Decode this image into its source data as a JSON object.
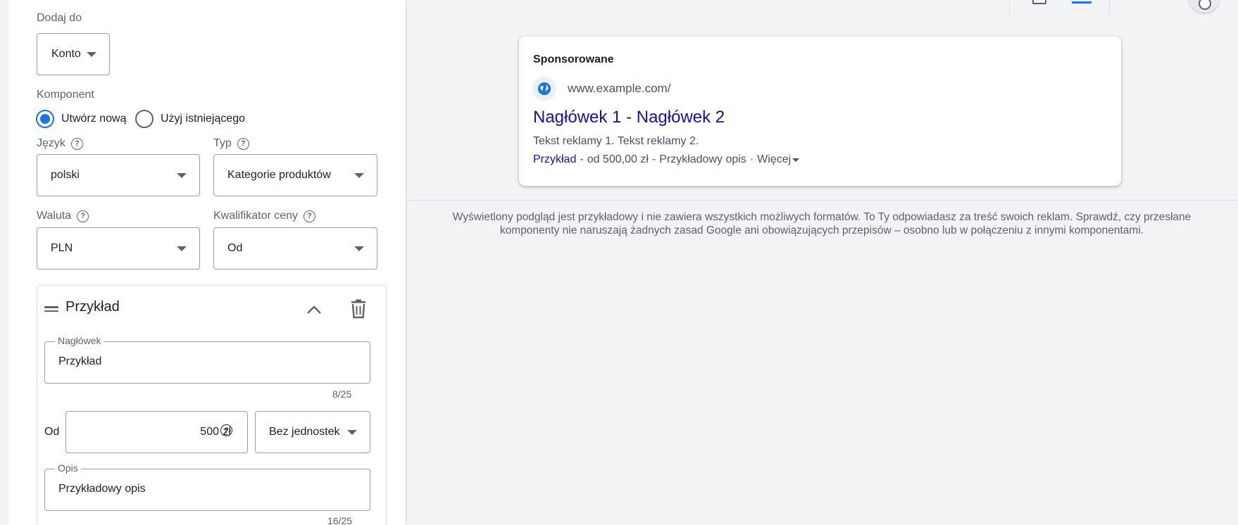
{
  "form": {
    "add_to": {
      "label": "Dodaj do",
      "value": "Konto"
    },
    "component": {
      "label": "Komponent",
      "create_new": "Utwórz nową",
      "use_existing": "Użyj istniejącego",
      "selected": "create_new"
    },
    "language": {
      "label": "Język",
      "value": "polski"
    },
    "type": {
      "label": "Typ",
      "value": "Kategorie produktów"
    },
    "currency": {
      "label": "Waluta",
      "value": "PLN"
    },
    "price_qualifier": {
      "label": "Kwalifikator ceny",
      "value": "Od"
    },
    "item": {
      "title": "Przykład",
      "headline": {
        "label": "Nagłówek",
        "value": "Przykład",
        "counter": "8/25"
      },
      "price": {
        "label": "Od",
        "value": "500",
        "unit_symbol": "zł",
        "unit": "Bez jednostek"
      },
      "description": {
        "label": "Opis",
        "value": "Przykładowy opis",
        "counter": "16/25"
      }
    }
  },
  "preview": {
    "sponsored": "Sponsorowane",
    "url": "www.example.com/",
    "headline": "Nagłówek 1 - Nagłówek 2",
    "text": "Tekst reklamy 1. Tekst reklamy 2.",
    "link_item": "Przykład",
    "dash1": "-",
    "price": "od 500,00 zł",
    "dash2": "-",
    "desc": "Przykładowy opis",
    "dot": "·",
    "more": "Więcej",
    "disclaimer": "Wyświetlony podgląd jest przykładowy i nie zawiera wszystkich możliwych formatów. To Ty odpowiadasz za treść swoich reklam. Sprawdź, czy przesłane komponenty nie naruszają żadnych zasad Google ani obowiązujących przepisów – osobno lub w połączeniu z innymi komponentami."
  },
  "colors": {
    "accent": "#1a73e8",
    "link": "#1a0dab",
    "muted": "#5f6368"
  }
}
